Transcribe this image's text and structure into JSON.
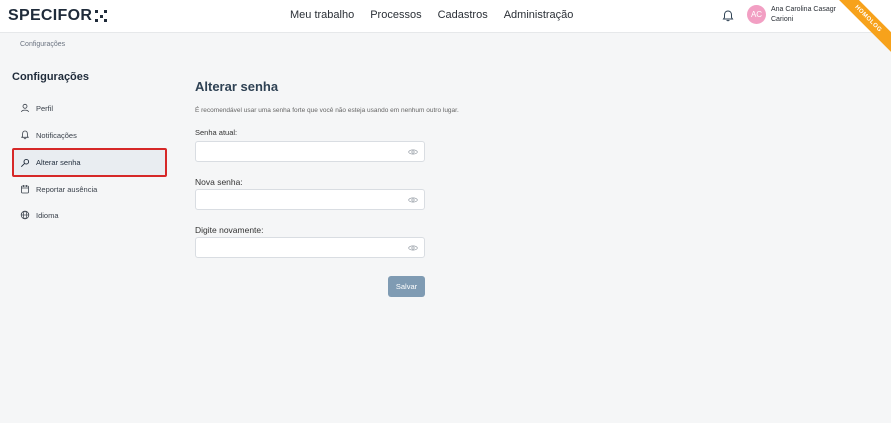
{
  "header": {
    "logo_text": "SPECIFOR",
    "nav": [
      "Meu trabalho",
      "Processos",
      "Cadastros",
      "Administração"
    ],
    "avatar_initials": "AC",
    "user_name_line1": "Ana Carolina Casagr",
    "user_name_line2": "Carioni",
    "env_ribbon": "HOMOLOG"
  },
  "breadcrumb": "Configurações",
  "sidebar": {
    "title": "Configurações",
    "items": [
      {
        "label": "Perfil",
        "icon": "user-icon"
      },
      {
        "label": "Notificações",
        "icon": "bell-icon"
      },
      {
        "label": "Alterar senha",
        "icon": "key-icon",
        "active": true
      },
      {
        "label": "Reportar ausência",
        "icon": "calendar-icon"
      },
      {
        "label": "Idioma",
        "icon": "globe-icon"
      }
    ]
  },
  "main": {
    "title": "Alterar senha",
    "hint": "É recomendável usar uma senha forte que você não esteja usando em nenhum outro lugar.",
    "fields": [
      {
        "label": "Senha atual:",
        "value": ""
      },
      {
        "label": "Nova senha:",
        "value": ""
      },
      {
        "label": "Digite novamente:",
        "value": ""
      }
    ],
    "save_label": "Salvar"
  },
  "colors": {
    "primary_button": "#7f9bb3",
    "active_border": "#d62828",
    "ribbon": "#f7a21b",
    "avatar": "#f29fc3"
  }
}
